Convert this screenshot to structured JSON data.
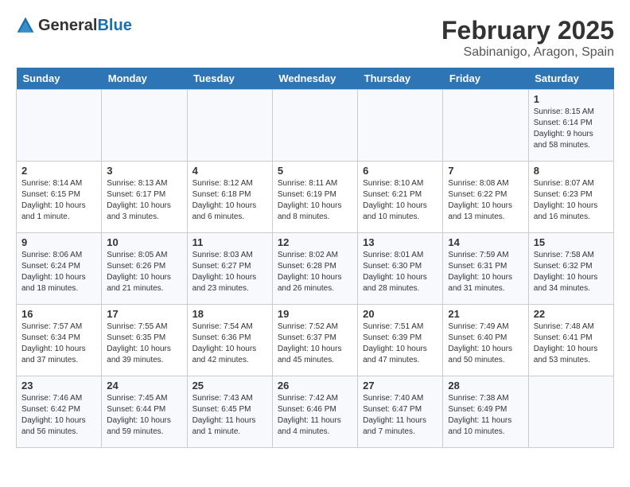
{
  "header": {
    "logo_general": "General",
    "logo_blue": "Blue",
    "month_year": "February 2025",
    "location": "Sabinanigo, Aragon, Spain"
  },
  "days_of_week": [
    "Sunday",
    "Monday",
    "Tuesday",
    "Wednesday",
    "Thursday",
    "Friday",
    "Saturday"
  ],
  "weeks": [
    [
      {
        "day": "",
        "info": ""
      },
      {
        "day": "",
        "info": ""
      },
      {
        "day": "",
        "info": ""
      },
      {
        "day": "",
        "info": ""
      },
      {
        "day": "",
        "info": ""
      },
      {
        "day": "",
        "info": ""
      },
      {
        "day": "1",
        "info": "Sunrise: 8:15 AM\nSunset: 6:14 PM\nDaylight: 9 hours and 58 minutes."
      }
    ],
    [
      {
        "day": "2",
        "info": "Sunrise: 8:14 AM\nSunset: 6:15 PM\nDaylight: 10 hours and 1 minute."
      },
      {
        "day": "3",
        "info": "Sunrise: 8:13 AM\nSunset: 6:17 PM\nDaylight: 10 hours and 3 minutes."
      },
      {
        "day": "4",
        "info": "Sunrise: 8:12 AM\nSunset: 6:18 PM\nDaylight: 10 hours and 6 minutes."
      },
      {
        "day": "5",
        "info": "Sunrise: 8:11 AM\nSunset: 6:19 PM\nDaylight: 10 hours and 8 minutes."
      },
      {
        "day": "6",
        "info": "Sunrise: 8:10 AM\nSunset: 6:21 PM\nDaylight: 10 hours and 10 minutes."
      },
      {
        "day": "7",
        "info": "Sunrise: 8:08 AM\nSunset: 6:22 PM\nDaylight: 10 hours and 13 minutes."
      },
      {
        "day": "8",
        "info": "Sunrise: 8:07 AM\nSunset: 6:23 PM\nDaylight: 10 hours and 16 minutes."
      }
    ],
    [
      {
        "day": "9",
        "info": "Sunrise: 8:06 AM\nSunset: 6:24 PM\nDaylight: 10 hours and 18 minutes."
      },
      {
        "day": "10",
        "info": "Sunrise: 8:05 AM\nSunset: 6:26 PM\nDaylight: 10 hours and 21 minutes."
      },
      {
        "day": "11",
        "info": "Sunrise: 8:03 AM\nSunset: 6:27 PM\nDaylight: 10 hours and 23 minutes."
      },
      {
        "day": "12",
        "info": "Sunrise: 8:02 AM\nSunset: 6:28 PM\nDaylight: 10 hours and 26 minutes."
      },
      {
        "day": "13",
        "info": "Sunrise: 8:01 AM\nSunset: 6:30 PM\nDaylight: 10 hours and 28 minutes."
      },
      {
        "day": "14",
        "info": "Sunrise: 7:59 AM\nSunset: 6:31 PM\nDaylight: 10 hours and 31 minutes."
      },
      {
        "day": "15",
        "info": "Sunrise: 7:58 AM\nSunset: 6:32 PM\nDaylight: 10 hours and 34 minutes."
      }
    ],
    [
      {
        "day": "16",
        "info": "Sunrise: 7:57 AM\nSunset: 6:34 PM\nDaylight: 10 hours and 37 minutes."
      },
      {
        "day": "17",
        "info": "Sunrise: 7:55 AM\nSunset: 6:35 PM\nDaylight: 10 hours and 39 minutes."
      },
      {
        "day": "18",
        "info": "Sunrise: 7:54 AM\nSunset: 6:36 PM\nDaylight: 10 hours and 42 minutes."
      },
      {
        "day": "19",
        "info": "Sunrise: 7:52 AM\nSunset: 6:37 PM\nDaylight: 10 hours and 45 minutes."
      },
      {
        "day": "20",
        "info": "Sunrise: 7:51 AM\nSunset: 6:39 PM\nDaylight: 10 hours and 47 minutes."
      },
      {
        "day": "21",
        "info": "Sunrise: 7:49 AM\nSunset: 6:40 PM\nDaylight: 10 hours and 50 minutes."
      },
      {
        "day": "22",
        "info": "Sunrise: 7:48 AM\nSunset: 6:41 PM\nDaylight: 10 hours and 53 minutes."
      }
    ],
    [
      {
        "day": "23",
        "info": "Sunrise: 7:46 AM\nSunset: 6:42 PM\nDaylight: 10 hours and 56 minutes."
      },
      {
        "day": "24",
        "info": "Sunrise: 7:45 AM\nSunset: 6:44 PM\nDaylight: 10 hours and 59 minutes."
      },
      {
        "day": "25",
        "info": "Sunrise: 7:43 AM\nSunset: 6:45 PM\nDaylight: 11 hours and 1 minute."
      },
      {
        "day": "26",
        "info": "Sunrise: 7:42 AM\nSunset: 6:46 PM\nDaylight: 11 hours and 4 minutes."
      },
      {
        "day": "27",
        "info": "Sunrise: 7:40 AM\nSunset: 6:47 PM\nDaylight: 11 hours and 7 minutes."
      },
      {
        "day": "28",
        "info": "Sunrise: 7:38 AM\nSunset: 6:49 PM\nDaylight: 11 hours and 10 minutes."
      },
      {
        "day": "",
        "info": ""
      }
    ]
  ]
}
